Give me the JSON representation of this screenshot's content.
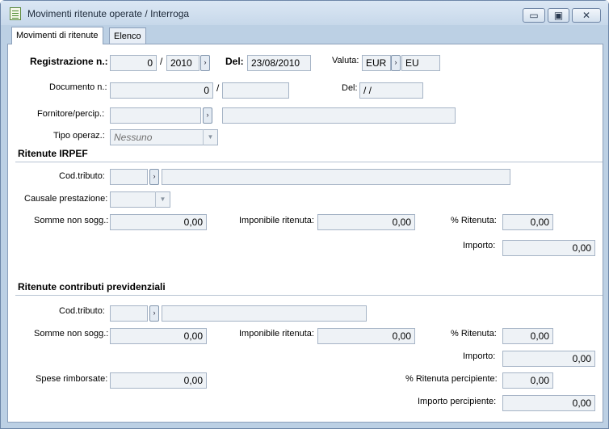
{
  "window": {
    "title": "Movimenti ritenute operate / Interroga",
    "minimize_glyph": "▭",
    "maximize_glyph": "▣",
    "close_glyph": "✕"
  },
  "tabs": [
    {
      "label": "Movimenti di ritenute",
      "active": true
    },
    {
      "label": "Elenco",
      "active": false
    }
  ],
  "header": {
    "registrazione_label": "Registrazione n.:",
    "registrazione_num": "0",
    "slash": "/",
    "registrazione_anno": "2010",
    "del_label": "Del:",
    "del_value": "23/08/2010",
    "valuta_label": "Valuta:",
    "valuta_code": "EUR",
    "valuta_desc": "EU",
    "documento_label": "Documento n.:",
    "documento_num": "0",
    "documento_serie": "",
    "doc_del_label": "Del:",
    "doc_del_value": "  /  /",
    "fornitore_label": "Fornitore/percip.:",
    "fornitore_code": "",
    "fornitore_desc": "",
    "tipo_label": "Tipo operaz.:",
    "tipo_value": "Nessuno"
  },
  "irpef": {
    "section_title": "Ritenute IRPEF",
    "cod_tributo_label": "Cod.tributo:",
    "cod_tributo": "",
    "cod_tributo_desc": "",
    "causale_label": "Causale prestazione:",
    "causale_value": "",
    "somme_label": "Somme non sogg.:",
    "somme_value": "0,00",
    "imponibile_label": "Imponibile ritenuta:",
    "imponibile_value": "0,00",
    "perc_label": "% Ritenuta:",
    "perc_value": "0,00",
    "importo_label": "Importo:",
    "importo_value": "0,00"
  },
  "contributi": {
    "section_title": "Ritenute contributi previdenziali",
    "cod_tributo_label": "Cod.tributo:",
    "cod_tributo": "",
    "cod_tributo_desc": "",
    "somme_label": "Somme non sogg.:",
    "somme_value": "0,00",
    "imponibile_label": "Imponibile ritenuta:",
    "imponibile_value": "0,00",
    "perc_label": "% Ritenuta:",
    "perc_value": "0,00",
    "importo_label": "Importo:",
    "importo_value": "0,00",
    "spese_label": "Spese rimborsate:",
    "spese_value": "0,00",
    "perc_percipiente_label": "% Ritenuta percipiente:",
    "perc_percipiente_value": "0,00",
    "importo_percipiente_label": "Importo percipiente:",
    "importo_percipiente_value": "0,00"
  },
  "icons": {
    "zoom": "zoom-arrow-icon",
    "dropdown": "chevron-down-icon",
    "zoom_glyph": "›",
    "dropdown_glyph": "▼"
  }
}
